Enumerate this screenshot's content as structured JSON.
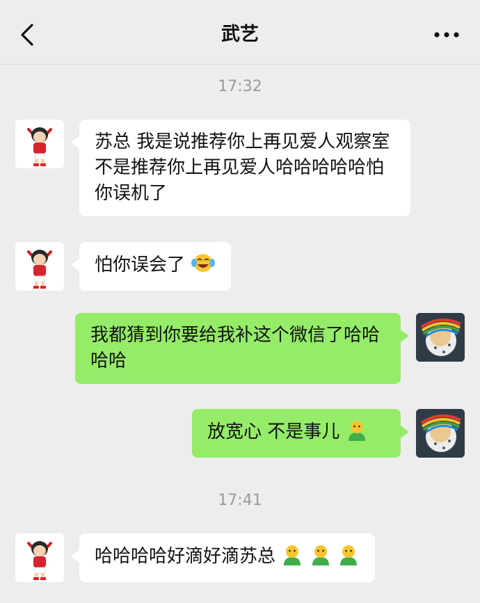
{
  "header": {
    "title": "武艺",
    "back_icon": "chevron-left-icon",
    "more_icon": "more-dots-icon"
  },
  "messages": [
    {
      "type": "timestamp",
      "text": "17:32"
    },
    {
      "type": "incoming",
      "text": "苏总 我是说推荐你上再见爱人观察室 不是推荐你上再见爱人哈哈哈哈哈怕你误机了",
      "avatar": "cartoon-football-player-avatar"
    },
    {
      "type": "incoming",
      "text": "怕你误会了",
      "emoji": "tears-of-joy-emoji",
      "avatar": "cartoon-football-player-avatar"
    },
    {
      "type": "outgoing",
      "text": "我都猜到你要给我补这个微信了哈哈哈哈",
      "avatar": "colorful-hat-avatar"
    },
    {
      "type": "outgoing",
      "text": "放宽心 不是事儿",
      "emoji": "green-shirt-person-emoji",
      "avatar": "colorful-hat-avatar"
    },
    {
      "type": "timestamp",
      "text": "17:41"
    },
    {
      "type": "incoming",
      "text": "哈哈哈哈好滴好滴苏总",
      "emoji": "green-shirt-person-emoji ×3",
      "avatar": "cartoon-football-player-avatar"
    }
  ],
  "colors": {
    "background": "#ededed",
    "incoming_bubble": "#ffffff",
    "outgoing_bubble": "#95ec69",
    "timestamp": "#9a9a9a"
  }
}
